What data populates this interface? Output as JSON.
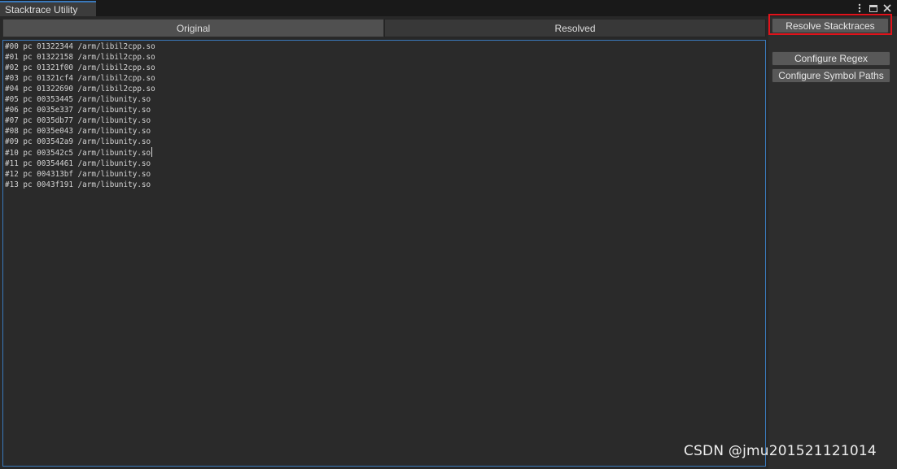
{
  "window": {
    "tab_title": "Stacktrace Utility",
    "menu_icon": "kebab-menu-icon",
    "maximize_icon": "maximize-icon",
    "close_icon": "close-icon"
  },
  "toolbar": {
    "tabs": [
      {
        "label": "Original",
        "active": true
      },
      {
        "label": "Resolved",
        "active": false
      }
    ]
  },
  "stacktrace": {
    "lines": [
      "#00 pc 01322344 /arm/libil2cpp.so",
      "#01 pc 01322158 /arm/libil2cpp.so",
      "#02 pc 01321f00 /arm/libil2cpp.so",
      "#03 pc 01321cf4 /arm/libil2cpp.so",
      "#04 pc 01322690 /arm/libil2cpp.so",
      "#05 pc 00353445 /arm/libunity.so",
      "#06 pc 0035e337 /arm/libunity.so",
      "#07 pc 0035db77 /arm/libunity.so",
      "#08 pc 0035e043 /arm/libunity.so",
      "#09 pc 003542a9 /arm/libunity.so",
      "#10 pc 003542c5 /arm/libunity.so",
      "#11 pc 00354461 /arm/libunity.so",
      "#12 pc 004313bf /arm/libunity.so",
      "#13 pc 0043f191 /arm/libunity.so"
    ],
    "caret_line": 10
  },
  "side_panel": {
    "resolve_label": "Resolve Stacktraces",
    "configure_regex_label": "Configure Regex",
    "configure_symbol_paths_label": "Configure Symbol Paths"
  },
  "watermark": {
    "text": "CSDN @jmu201521121014"
  },
  "colors": {
    "accent": "#3a79bb",
    "highlight": "#e0131b"
  }
}
